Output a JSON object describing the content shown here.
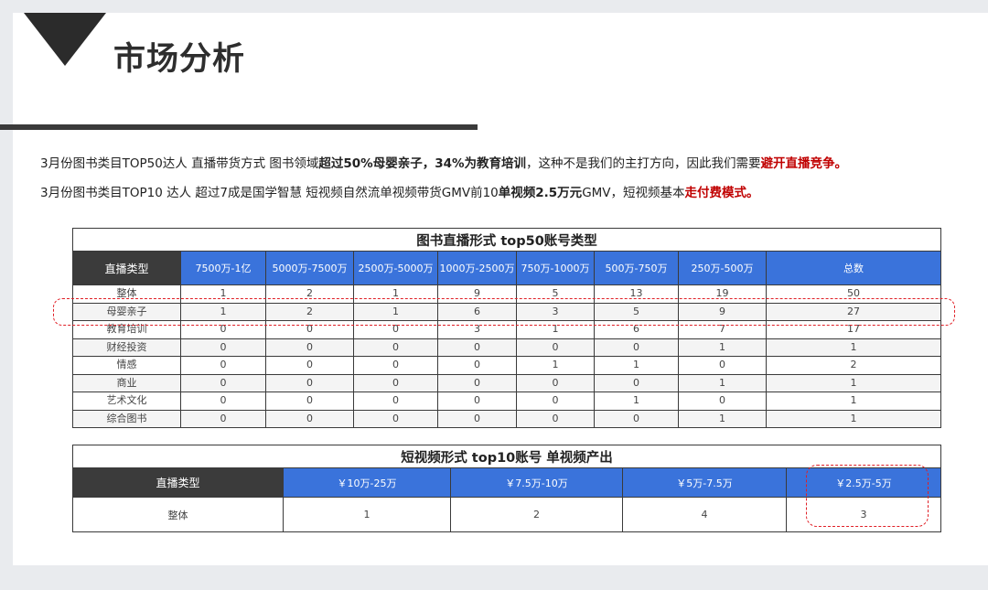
{
  "title": "市场分析",
  "paragraphs": {
    "p1": {
      "s1": "3月份图书类目TOP50达人 直播带货方式 图书领域",
      "b1": "超过50%母婴亲子，34%为教育培训",
      "s2": "，这种不是我们的主打方向，因此我们需要",
      "r1": "避开直播竞争。"
    },
    "p2": {
      "s1": "3月份图书类目TOP10 达人 超过7成是国学智慧 短视频自然流单视频带货GMV前10",
      "b1": "单视频2.5万元",
      "b2": "GMV",
      "s2": "，短视频基本",
      "r1": "走付费模式。"
    }
  },
  "table1": {
    "caption": "图书直播形式 top50账号类型",
    "headers": [
      "直播类型",
      "7500万-1亿",
      "5000万-7500万",
      "2500万-5000万",
      "1000万-2500万",
      "750万-1000万",
      "500万-750万",
      "250万-500万",
      "总数"
    ],
    "rows": [
      [
        "整体",
        "1",
        "2",
        "1",
        "9",
        "5",
        "13",
        "19",
        "50"
      ],
      [
        "母婴亲子",
        "1",
        "2",
        "1",
        "6",
        "3",
        "5",
        "9",
        "27"
      ],
      [
        "教育培训",
        "0",
        "0",
        "0",
        "3",
        "1",
        "6",
        "7",
        "17"
      ],
      [
        "财经投资",
        "0",
        "0",
        "0",
        "0",
        "0",
        "0",
        "1",
        "1"
      ],
      [
        "情感",
        "0",
        "0",
        "0",
        "0",
        "1",
        "1",
        "0",
        "2"
      ],
      [
        "商业",
        "0",
        "0",
        "0",
        "0",
        "0",
        "0",
        "1",
        "1"
      ],
      [
        "艺术文化",
        "0",
        "0",
        "0",
        "0",
        "0",
        "1",
        "0",
        "1"
      ],
      [
        "综合图书",
        "0",
        "0",
        "0",
        "0",
        "0",
        "0",
        "1",
        "1"
      ]
    ]
  },
  "table2": {
    "caption": "短视频形式 top10账号 单视频产出",
    "headers": [
      "直播类型",
      "￥10万-25万",
      "￥7.5万-10万",
      "￥5万-7.5万",
      "￥2.5万-5万"
    ],
    "rows": [
      [
        "整体",
        "1",
        "2",
        "4",
        "3"
      ]
    ]
  },
  "colors": {
    "header_dark": "#3b3b3b",
    "header_blue": "#3a73db",
    "highlight_red": "#c00000",
    "dash_red": "#e01f26"
  }
}
